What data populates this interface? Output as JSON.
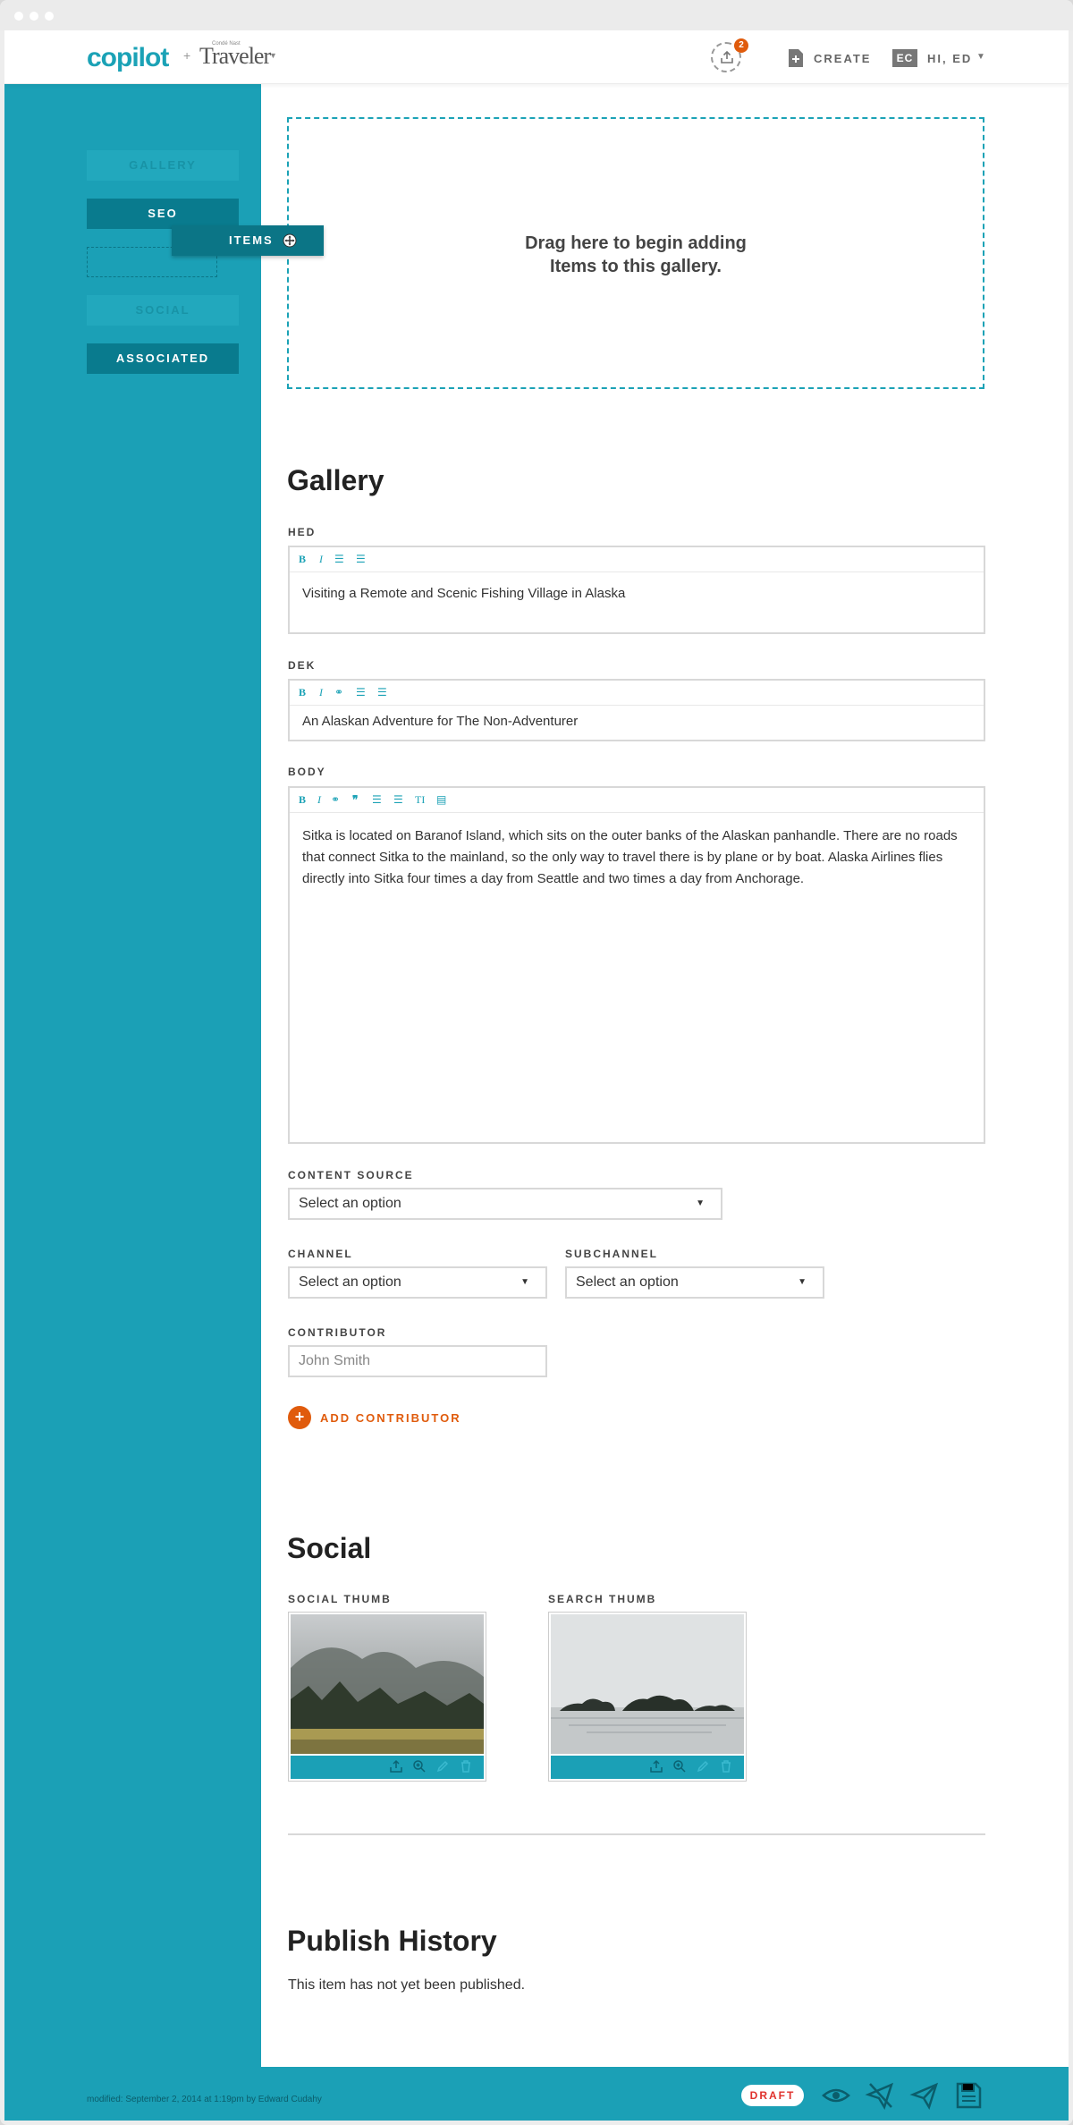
{
  "header": {
    "logo": "copilot",
    "logo_plus": "+",
    "brand": "Traveler",
    "brand_top": "Condé Nast",
    "upload_count": "2",
    "create_label": "CREATE",
    "user_initials": "EC",
    "user_label": "HI, ED"
  },
  "sidebar": {
    "items": [
      {
        "label": "GALLERY"
      },
      {
        "label": "SEO"
      },
      {
        "label": "ITEMS"
      },
      {
        "label": "SOCIAL"
      },
      {
        "label": "ASSOCIATED"
      }
    ]
  },
  "dropzone": {
    "text": "Drag here to begin adding Items to this gallery."
  },
  "gallery": {
    "title": "Gallery",
    "hed_label": "HED",
    "hed_value": "Visiting a Remote and Scenic Fishing Village in Alaska",
    "dek_label": "DEK",
    "dek_value": "An Alaskan Adventure for The Non-Adventurer",
    "body_label": "BODY",
    "body_value": "Sitka is located on Baranof Island, which sits on the outer banks of the Alaskan panhandle. There are no roads that connect Sitka to the mainland, so the only way to travel there is by plane or by boat. Alaska Airlines flies directly into Sitka four times a day from Seattle and two times a day from Anchorage.",
    "content_source_label": "CONTENT SOURCE",
    "content_source_value": "Select an option",
    "channel_label": "CHANNEL",
    "channel_value": "Select an option",
    "subchannel_label": "SUBCHANNEL",
    "subchannel_value": "Select an option",
    "contributor_label": "CONTRIBUTOR",
    "contributor_placeholder": "John Smith",
    "add_contributor_label": "ADD CONTRIBUTOR"
  },
  "social": {
    "title": "Social",
    "social_thumb_label": "SOCIAL THUMB",
    "search_thumb_label": "SEARCH THUMB"
  },
  "history": {
    "title": "Publish History",
    "text": "This item has not yet been published."
  },
  "footer": {
    "modified": "modified: September 2, 2014 at 1:19pm by Edward Cudahy",
    "status": "DRAFT"
  },
  "colors": {
    "accent": "#1ba0b6",
    "accent_dark": "#097b8e",
    "orange": "#e05b0c",
    "draft_red": "#e0312c"
  }
}
